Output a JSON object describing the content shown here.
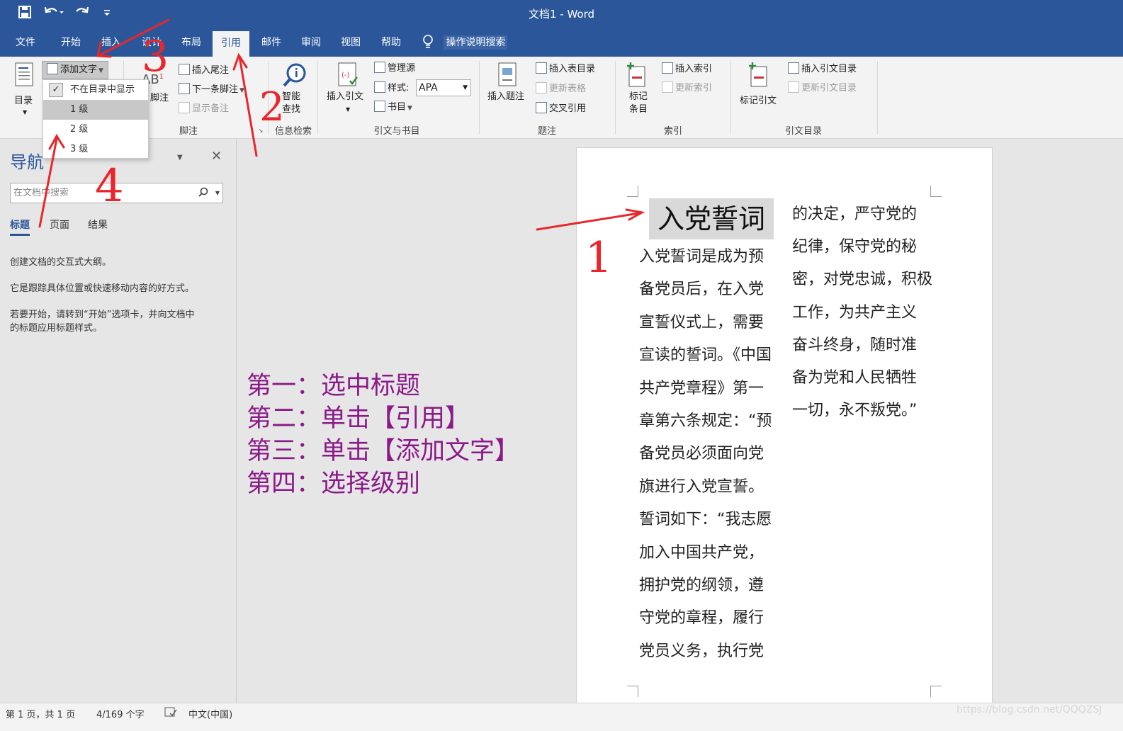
{
  "window": {
    "title": "文档1  -  Word"
  },
  "quick_access": {
    "save_icon": "save-icon",
    "undo_icon": "undo-icon",
    "redo_icon": "redo-icon",
    "customize_icon": "customize-icon"
  },
  "tabs": [
    {
      "label": "文件"
    },
    {
      "label": "开始"
    },
    {
      "label": "插入"
    },
    {
      "label": "设计"
    },
    {
      "label": "布局"
    },
    {
      "label": "引用"
    },
    {
      "label": "邮件"
    },
    {
      "label": "审阅"
    },
    {
      "label": "视图"
    },
    {
      "label": "帮助"
    }
  ],
  "tell_me": "操作说明搜索",
  "ribbon": {
    "toc": {
      "label": "目录",
      "add_text": "添加文字"
    },
    "footnote": {
      "group": "脚注",
      "insert_footnote": "脚注",
      "insert_endnote": "插入尾注",
      "next_footnote": "下一条脚注",
      "show_notes": "显示备注"
    },
    "research": {
      "group": "信息检索",
      "smart_lookup_1": "智能",
      "smart_lookup_2": "查找"
    },
    "citations": {
      "group": "引文与书目",
      "insert_citation": "插入引文",
      "manage_sources": "管理源",
      "style_label": "样式:",
      "style_value": "APA",
      "bibliography": "书目"
    },
    "captions": {
      "group": "题注",
      "insert_caption": "插入题注",
      "insert_table_of_figures": "插入表目录",
      "update_table": "更新表格",
      "cross_reference": "交叉引用"
    },
    "index": {
      "group": "索引",
      "mark_entry_1": "标记",
      "mark_entry_2": "条目",
      "insert_index": "插入索引",
      "update_index": "更新索引"
    },
    "authorities": {
      "group": "引文目录",
      "mark_citation": "标记引文",
      "insert_toa": "插入引文目录",
      "update_toa": "更新引文目录"
    }
  },
  "dropdown": {
    "items": [
      {
        "label": "不在目录中显示",
        "checked": true
      },
      {
        "label": "1 级",
        "hover": true
      },
      {
        "label": "2 级"
      },
      {
        "label": "3 级"
      }
    ]
  },
  "navigation": {
    "title": "导航",
    "search_placeholder": "在文档中搜索",
    "tabs": [
      {
        "label": "标题",
        "active": true
      },
      {
        "label": "页面"
      },
      {
        "label": "结果"
      }
    ],
    "p1": "创建文档的交互式大纲。",
    "p2": "它是跟踪具体位置或快速移动内容的好方式。",
    "p3a": "若要开始，请转到“开始”选项卡，并向文档中",
    "p3b": "的标题应用标题样式。"
  },
  "document": {
    "heading": "入党誓词",
    "col1": [
      "入党誓词是成为预",
      "备党员后，在入党",
      "宣誓仪式上，需要",
      "宣读的誓词。《中国",
      "共产党章程》第一",
      "章第六条规定：“预",
      "备党员必须面向党",
      "旗进行入党宣誓。",
      "誓词如下：“我志愿",
      "加入中国共产党，",
      "拥护党的纲领，遵",
      "守党的章程，履行",
      "党员义务，执行党"
    ],
    "col2": [
      "的决定，严守党的",
      "纪律，保守党的秘",
      "密，对党忠诚，积极",
      "工作，为共产主义",
      "奋斗终身，随时准",
      "备为党和人民牺牲",
      "一切，永不叛党。”"
    ]
  },
  "instructions": [
    "第一：选中标题",
    "第二：单击【引用】",
    "第三：单击【添加文字】",
    "第四：选择级别"
  ],
  "annotations": {
    "n1": "1",
    "n2": "2",
    "n3": "3",
    "n4": "4",
    "color": "#e8262b"
  },
  "status": {
    "page": "第 1 页，共 1 页",
    "words": "4/169 个字",
    "language": "中文(中国)"
  },
  "watermark": "https://blog.csdn.net/QQQZSJ"
}
